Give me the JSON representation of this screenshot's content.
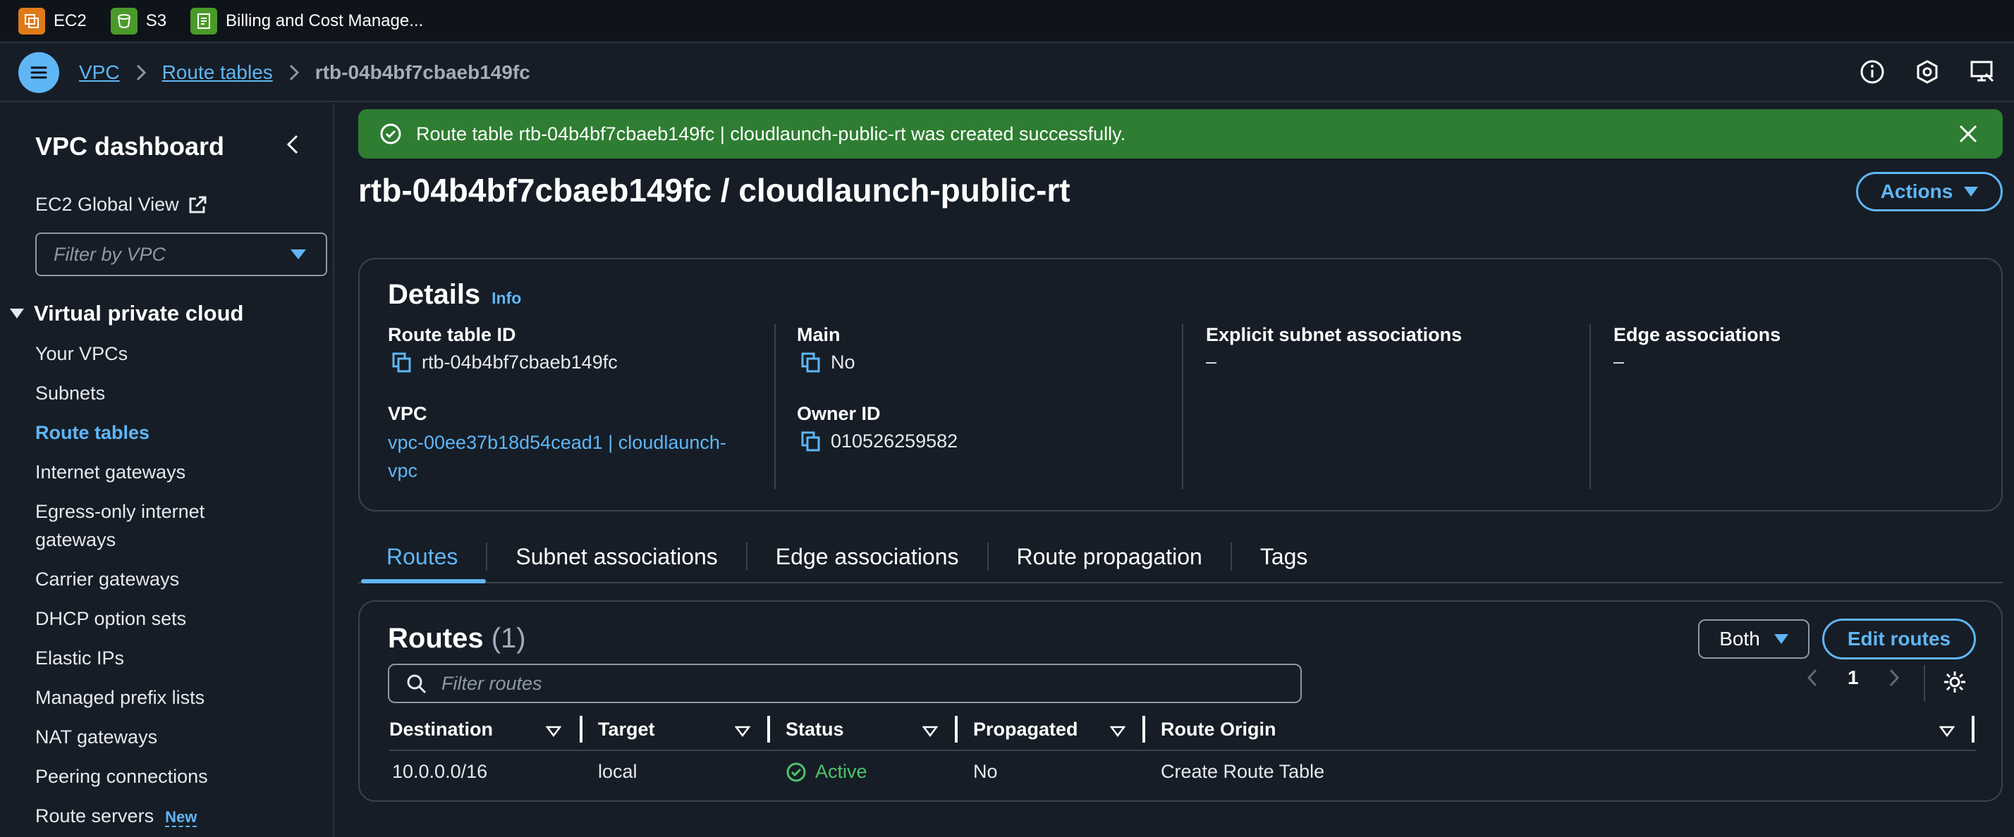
{
  "favorites": [
    {
      "label": "EC2",
      "color": "#e07a18",
      "icon": "ec2-icon"
    },
    {
      "label": "S3",
      "color": "#4a9a2a",
      "icon": "s3-icon"
    },
    {
      "label": "Billing and Cost Manage...",
      "color": "#4a9a2a",
      "icon": "billing-icon"
    }
  ],
  "breadcrumb": {
    "items": [
      "VPC",
      "Route tables"
    ],
    "current": "rtb-04b4bf7cbaeb149fc"
  },
  "sidebar": {
    "title": "VPC dashboard",
    "global_view": "EC2 Global View",
    "filter_placeholder": "Filter by VPC",
    "section": "Virtual private cloud",
    "items": [
      {
        "label": "Your VPCs"
      },
      {
        "label": "Subnets"
      },
      {
        "label": "Route tables",
        "active": true
      },
      {
        "label": "Internet gateways"
      },
      {
        "label": "Egress-only internet gateways"
      },
      {
        "label": "Carrier gateways"
      },
      {
        "label": "DHCP option sets"
      },
      {
        "label": "Elastic IPs"
      },
      {
        "label": "Managed prefix lists"
      },
      {
        "label": "NAT gateways"
      },
      {
        "label": "Peering connections"
      },
      {
        "label": "Route servers",
        "badge": "New"
      }
    ]
  },
  "flash": {
    "message": "Route table rtb-04b4bf7cbaeb149fc | cloudlaunch-public-rt was created successfully.",
    "color": "#2e7d32"
  },
  "page": {
    "title": "rtb-04b4bf7cbaeb149fc / cloudlaunch-public-rt",
    "actions_label": "Actions"
  },
  "details": {
    "title": "Details",
    "info": "Info",
    "route_table_id_label": "Route table ID",
    "route_table_id": "rtb-04b4bf7cbaeb149fc",
    "main_label": "Main",
    "main": "No",
    "explicit_label": "Explicit subnet associations",
    "explicit": "–",
    "edge_label": "Edge associations",
    "edge": "–",
    "vpc_label": "VPC",
    "vpc": "vpc-00ee37b18d54cead1 | cloudlaunch-vpc",
    "owner_label": "Owner ID",
    "owner": "010526259582"
  },
  "tabs": [
    "Routes",
    "Subnet associations",
    "Edge associations",
    "Route propagation",
    "Tags"
  ],
  "routes": {
    "title": "Routes",
    "count": "(1)",
    "both_label": "Both",
    "edit_label": "Edit routes",
    "filter_placeholder": "Filter routes",
    "page": "1",
    "columns": [
      "Destination",
      "Target",
      "Status",
      "Propagated",
      "Route Origin"
    ],
    "rows": [
      {
        "destination": "10.0.0.0/16",
        "target": "local",
        "status": "Active",
        "propagated": "No",
        "origin": "Create Route Table"
      }
    ]
  }
}
